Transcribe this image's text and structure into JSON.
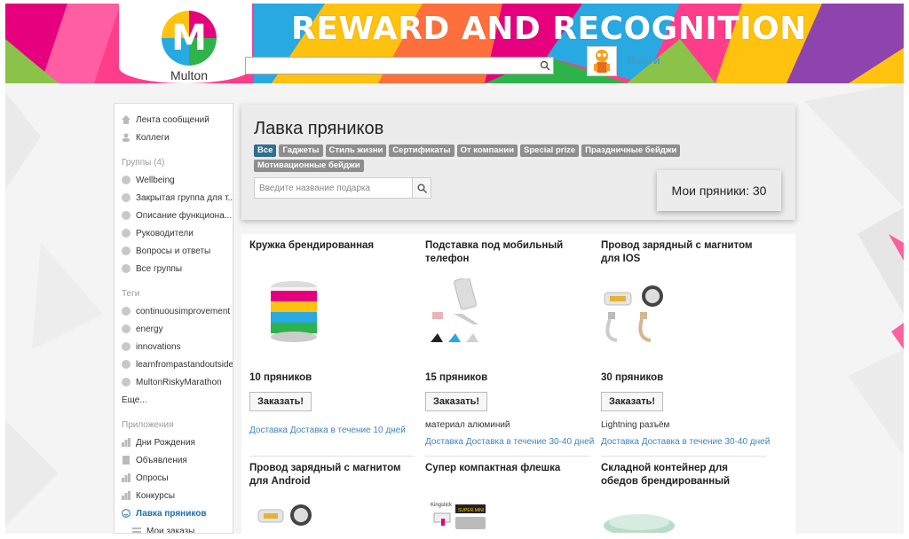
{
  "header": {
    "logo_letter": "M",
    "logo_text": "Multon",
    "title": "REWARD AND RECOGNITION",
    "search_placeholder": "",
    "user_name": "Мулти"
  },
  "sidebar": {
    "main": [
      {
        "label": "Лента сообщений",
        "icon": "home-icon"
      },
      {
        "label": "Коллеги",
        "icon": "person-icon"
      }
    ],
    "groups_heading": "Группы (4)",
    "groups": [
      "Wellbeing",
      "Закрытая группа для т...",
      "Описание функциона...",
      "Руководители",
      "Вопросы и ответы",
      "Все группы"
    ],
    "tags_heading": "Теги",
    "tags": [
      "continuousimprovement",
      "energy",
      "innovations",
      "learnfrompastandoutside",
      "MultonRiskyMarathon"
    ],
    "more": "Еще...",
    "apps_heading": "Приложения",
    "apps": [
      "Дни Рождения",
      "Объявления",
      "Опросы",
      "Конкурсы"
    ],
    "active_app": "Лавка пряников",
    "sub_app": "Мои заказы"
  },
  "shop": {
    "title": "Лавка пряников",
    "categories": [
      "Все",
      "Гаджеты",
      "Стиль жизни",
      "Сертификаты",
      "От компании",
      "Special prize",
      "Праздничные бейджи",
      "Мотивационные бейджи"
    ],
    "active_category": "Все",
    "search_placeholder": "Введите название подарка",
    "balance": "Мои пряники: 30"
  },
  "products": [
    {
      "name": "Кружка брендированная",
      "price": "10 пряников",
      "order_label": "Заказать!",
      "desc": "",
      "delivery": "Доставка Доставка в течение 10 дней"
    },
    {
      "name": "Подставка под мобильный телефон",
      "price": "15 пряников",
      "order_label": "Заказать!",
      "desc": "материал алюминий",
      "delivery": "Доставка Доставка в течение 30-40 дней"
    },
    {
      "name": "Провод зарядный с магнитом для IOS",
      "price": "30 пряников",
      "order_label": "Заказать!",
      "desc": "Lightning разъём",
      "delivery": "Доставка Доставка в течение 30-40 дней"
    },
    {
      "name": "Провод зарядный с магнитом для Android"
    },
    {
      "name": "Супер компактная флешка",
      "img_label_1": "Kingstick",
      "img_label_2": "SUPER MINI"
    },
    {
      "name": "Складной контейнер для обедов брендированный"
    }
  ],
  "colors": {
    "accent_blue": "#3a86c4",
    "active_tag": "#2f6f8f",
    "tag": "#8e8e8e"
  }
}
